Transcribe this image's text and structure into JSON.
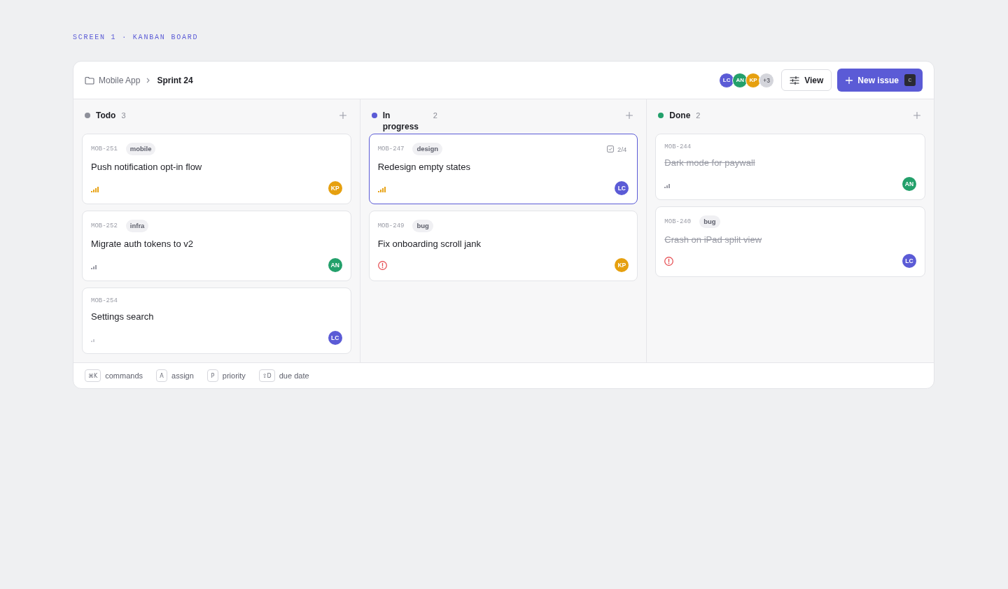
{
  "caption": "SCREEN 1 · KANBAN BOARD",
  "breadcrumb": {
    "parent": "Mobile App",
    "current": "Sprint 24"
  },
  "members": {
    "avatars": [
      {
        "initials": "LC",
        "color": "#5b5bd6"
      },
      {
        "initials": "AN",
        "color": "#23a06b"
      },
      {
        "initials": "KP",
        "color": "#e6a00f"
      }
    ],
    "more": "+3"
  },
  "view_button": "View",
  "new_issue_button": {
    "label": "New issue",
    "shortcut": "C"
  },
  "columns": [
    {
      "name": "Todo",
      "count": "3",
      "color": "#8d8f99",
      "cards": [
        {
          "id": "MOB-251",
          "tag": "mobile",
          "title": "Push notification opt-in flow",
          "priority": {
            "kind": "high"
          },
          "assignee": {
            "initials": "KP",
            "color": "#e6a00f"
          },
          "selected": false,
          "done": false
        },
        {
          "id": "MOB-252",
          "tag": "infra",
          "title": "Migrate auth tokens to v2",
          "priority": {
            "kind": "medium"
          },
          "assignee": {
            "initials": "AN",
            "color": "#23a06b"
          },
          "selected": false,
          "done": false
        },
        {
          "id": "MOB-254",
          "title": "Settings search",
          "priority": {
            "kind": "low"
          },
          "assignee": {
            "initials": "LC",
            "color": "#5b5bd6"
          },
          "selected": false,
          "done": false
        }
      ]
    },
    {
      "name": "In progress",
      "count": "2",
      "color": "#5b5bd6",
      "cards": [
        {
          "id": "MOB-247",
          "tag": "design",
          "checklist": "2/4",
          "title": "Redesign empty states",
          "priority": {
            "kind": "high"
          },
          "assignee": {
            "initials": "LC",
            "color": "#5b5bd6"
          },
          "selected": true,
          "done": false
        },
        {
          "id": "MOB-249",
          "tag": "bug",
          "title": "Fix onboarding scroll jank",
          "priority": {
            "kind": "urgent"
          },
          "assignee": {
            "initials": "KP",
            "color": "#e6a00f"
          },
          "selected": false,
          "done": false
        }
      ]
    },
    {
      "name": "Done",
      "count": "2",
      "color": "#23a06b",
      "cards": [
        {
          "id": "MOB-244",
          "title": "Dark mode for paywall",
          "priority": {
            "kind": "medium"
          },
          "assignee": {
            "initials": "AN",
            "color": "#23a06b"
          },
          "selected": false,
          "done": true
        },
        {
          "id": "MOB-240",
          "tag": "bug",
          "title": "Crash on iPad split view",
          "priority": {
            "kind": "urgent"
          },
          "assignee": {
            "initials": "LC",
            "color": "#5b5bd6"
          },
          "selected": false,
          "done": true
        }
      ]
    }
  ],
  "shortcuts": [
    {
      "key": "⌘K",
      "label": "commands"
    },
    {
      "key": "A",
      "label": "assign"
    },
    {
      "key": "P",
      "label": "priority"
    },
    {
      "key": "⇧D",
      "label": "due date"
    }
  ]
}
